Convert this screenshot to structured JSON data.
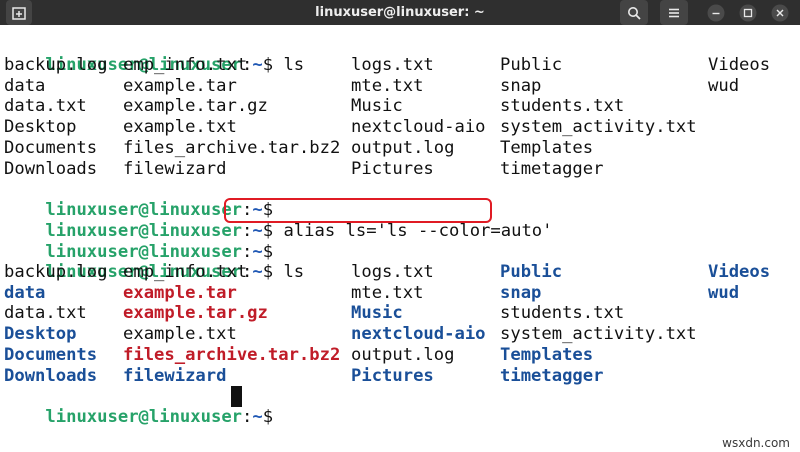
{
  "titlebar": {
    "title": "linuxuser@linuxuser: ~",
    "new_tab_icon": "new-tab-icon",
    "search_icon": "search-icon",
    "menu_icon": "hamburger-menu-icon",
    "minimize_icon": "minimize-icon",
    "maximize_icon": "maximize-icon",
    "close_icon": "close-icon"
  },
  "colors": {
    "prompt_user": "#26a269",
    "prompt_path": "#1f57b4",
    "directory": "#1a4f98",
    "archive": "#c01c28",
    "highlight_border": "#e01b24",
    "titlebar_bg": "#2f2f2f"
  },
  "terminal": {
    "prompt_user": "linuxuser@linuxuser",
    "prompt_path": "~",
    "prompt_suffix": "$",
    "cmd1": " ls",
    "cmd_alias": " alias ls='ls --color=auto'",
    "cmd2": " ls",
    "listing1": [
      [
        "backup.log",
        "emp_info.txt",
        "logs.txt",
        "Public",
        "Videos"
      ],
      [
        "data",
        "example.tar",
        "mte.txt",
        "snap",
        "wud"
      ],
      [
        "data.txt",
        "example.tar.gz",
        "Music",
        "students.txt",
        ""
      ],
      [
        "Desktop",
        "example.txt",
        "nextcloud-aio",
        "system_activity.txt",
        ""
      ],
      [
        "Documents",
        "files_archive.tar.bz2",
        "output.log",
        "Templates",
        ""
      ],
      [
        "Downloads",
        "filewizard",
        "Pictures",
        "timetagger",
        ""
      ]
    ],
    "listing2": [
      [
        "backup.log",
        "emp_info.txt",
        "logs.txt",
        "Public",
        "Videos"
      ],
      [
        "data",
        "example.tar",
        "mte.txt",
        "snap",
        "wud"
      ],
      [
        "data.txt",
        "example.tar.gz",
        "Music",
        "students.txt",
        ""
      ],
      [
        "Desktop",
        "example.txt",
        "nextcloud-aio",
        "system_activity.txt",
        ""
      ],
      [
        "Documents",
        "files_archive.tar.bz2",
        "output.log",
        "Templates",
        ""
      ],
      [
        "Downloads",
        "filewizard",
        "Pictures",
        "timetagger",
        ""
      ]
    ],
    "listing2_types": [
      [
        "file",
        "file",
        "file",
        "dir",
        "dir"
      ],
      [
        "dir",
        "archive",
        "file",
        "dir",
        "dir"
      ],
      [
        "file",
        "archive",
        "dir",
        "file",
        ""
      ],
      [
        "dir",
        "file",
        "dir",
        "file",
        ""
      ],
      [
        "dir",
        "archive",
        "file",
        "dir",
        ""
      ],
      [
        "dir",
        "dir",
        "dir",
        "dir",
        ""
      ]
    ]
  },
  "watermark": "wsxdn.com"
}
